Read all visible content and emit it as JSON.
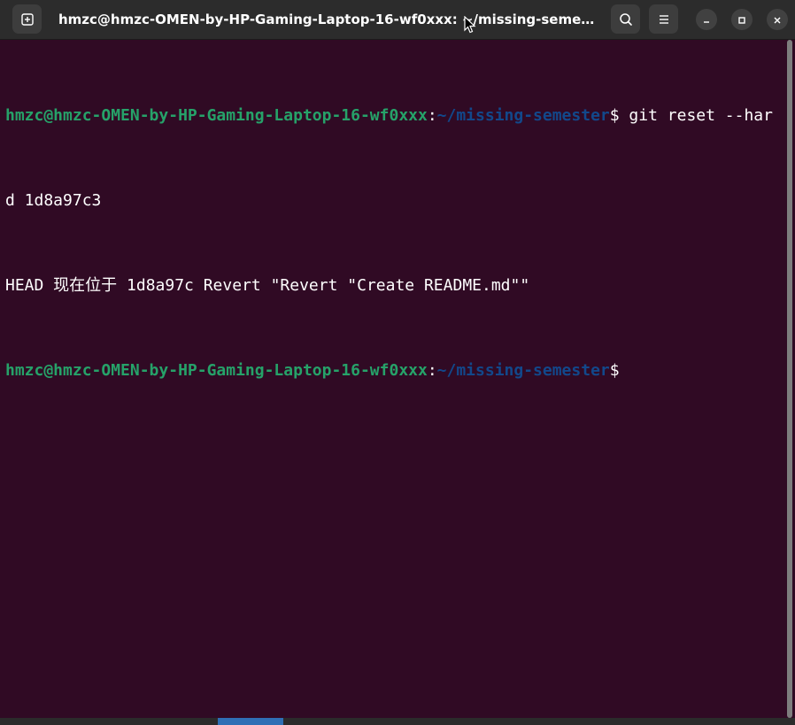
{
  "window": {
    "title": "hmzc@hmzc-OMEN-by-HP-Gaming-Laptop-16-wf0xxx: ~/missing-semester"
  },
  "terminal": {
    "lines": [
      {
        "user": "hmzc@hmzc-OMEN-by-HP-Gaming-Laptop-16-wf0xxx",
        "colon": ":",
        "path": "~/missing-semester",
        "dollar": "$",
        "command": " git reset --har"
      },
      {
        "text": "d 1d8a97c3"
      },
      {
        "text": "HEAD 现在位于 1d8a97c Revert \"Revert \"Create README.md\"\""
      },
      {
        "user": "hmzc@hmzc-OMEN-by-HP-Gaming-Laptop-16-wf0xxx",
        "colon": ":",
        "path": "~/missing-semester",
        "dollar": "$",
        "command": ""
      }
    ]
  },
  "colors": {
    "background": "#300a24",
    "user": "#26a269",
    "path": "#12488b",
    "text": "#ffffff",
    "titlebar": "#2c2c2c"
  },
  "icons": {
    "new_tab": "new-tab-icon",
    "search": "search-icon",
    "menu": "hamburger-menu-icon",
    "minimize": "minimize-icon",
    "maximize": "maximize-icon",
    "close": "close-icon"
  }
}
